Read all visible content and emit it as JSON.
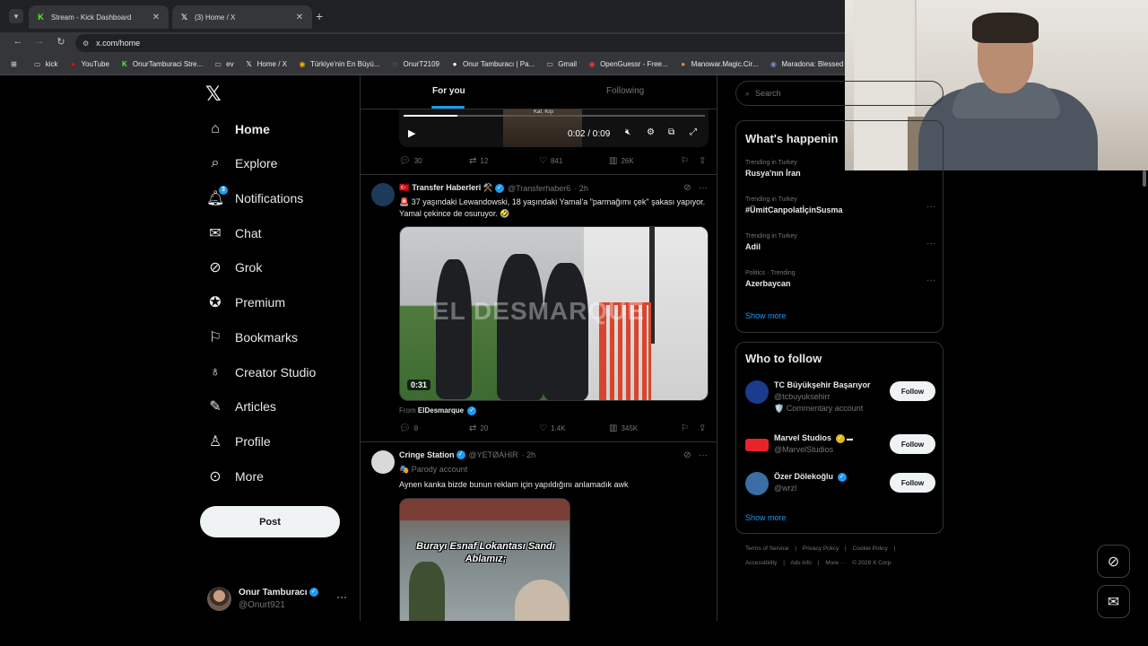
{
  "browser": {
    "tabs": [
      {
        "title": "Stream - Kick Dashboard",
        "favicon": "kick-logo",
        "color": "#53fc18",
        "active": false
      },
      {
        "title": "(3) Home / X",
        "favicon": "x-logo",
        "color": "#ffffff",
        "active": true
      }
    ],
    "url": "x.com/home",
    "bookmarks": [
      {
        "label": "kick",
        "icon": "folder-icon"
      },
      {
        "label": "YouTube",
        "icon": "youtube-icon"
      },
      {
        "label": "OnurTamburaci Stre...",
        "icon": "kick-icon"
      },
      {
        "label": "ev",
        "icon": "folder-icon"
      },
      {
        "label": "Home / X",
        "icon": "x-icon"
      },
      {
        "label": "Türkiye'nin En Büyü...",
        "icon": "globe-icon"
      },
      {
        "label": "OnurT2109",
        "icon": "globe-icon"
      },
      {
        "label": "Onur Tamburacı | Pa...",
        "icon": "patreon-icon"
      },
      {
        "label": "Gmail",
        "icon": "folder-icon"
      },
      {
        "label": "OpenGuessr - Free...",
        "icon": "opengeussr-icon"
      },
      {
        "label": "Manowar.Magic.Cir...",
        "icon": "bitcoin-icon"
      },
      {
        "label": "Maradona: Blessed",
        "icon": "globe-icon"
      }
    ]
  },
  "sidebar": {
    "items": [
      {
        "label": "Home",
        "icon": "home-icon"
      },
      {
        "label": "Explore",
        "icon": "search-icon"
      },
      {
        "label": "Notifications",
        "icon": "bell-icon",
        "badge": "3"
      },
      {
        "label": "Chat",
        "icon": "mail-icon"
      },
      {
        "label": "Grok",
        "icon": "grok-icon"
      },
      {
        "label": "Premium",
        "icon": "verified-icon"
      },
      {
        "label": "Bookmarks",
        "icon": "bookmark-icon"
      },
      {
        "label": "Creator Studio",
        "icon": "creator-icon"
      },
      {
        "label": "Articles",
        "icon": "article-icon"
      },
      {
        "label": "Profile",
        "icon": "person-icon"
      },
      {
        "label": "More",
        "icon": "more-circle-icon"
      }
    ],
    "post_label": "Post",
    "account": {
      "name": "Onur Tamburacı",
      "handle": "@Onurt921"
    }
  },
  "timeline": {
    "tabs": [
      "For you",
      "Following"
    ],
    "tweet1": {
      "video_time": "0:02 / 0:09",
      "video_thumb_text": "Kaf, Kişi",
      "progress": 0.18,
      "replies": "30",
      "reposts": "12",
      "likes": "841",
      "views": "26K"
    },
    "tweet2": {
      "name": "Transfer Haberleri ⚒️",
      "handle": "@Transferhaber6",
      "time": "· 2h",
      "text": "🚨 37 yaşındaki Lewandowski, 18 yaşındaki Yamal'a \"parmağımı çek\" şakası yapıyor. Yamal çekince de osuruyor. 🤣",
      "video_watermark": "EL DESMARQUE",
      "duration": "0:31",
      "from_label": "From",
      "from_name": "ElDesmarque",
      "replies": "8",
      "reposts": "20",
      "likes": "1.4K",
      "views": "345K"
    },
    "tweet3": {
      "name": "Cringe Station",
      "handle": "@YETØAHIR",
      "time": "· 2h",
      "badge": "🎭 Parody account",
      "text": "Aynen kanka bizde bunun reklam için yapıldığını anlamadık awk",
      "image_caption": "Burayı Esnaf Lokantası Sandı Ablamız;"
    }
  },
  "right": {
    "search_placeholder": "Search",
    "trends_title": "What's happenin",
    "trends": [
      {
        "meta": "Trending in Turkey",
        "name": "Rusya'nın İran"
      },
      {
        "meta": "Trending in Turkey",
        "name": "#ÜmitCanpolatİçinSusma"
      },
      {
        "meta": "Trending in Turkey",
        "name": "Adil"
      },
      {
        "meta": "Politics · Trending",
        "name": "Azerbaycan"
      }
    ],
    "show_more": "Show more",
    "wtf_title": "Who to follow",
    "who_to_follow": [
      {
        "name": "TC Büyükşehir Başarıyor",
        "handle": "@tcbuyuksehirr",
        "extra": "🛡️ Commentary account",
        "follow": "Follow",
        "avatar_color": "#1b3b8c"
      },
      {
        "name": "Marvel Studios",
        "handle": "@MarvelStudios",
        "extra": "",
        "follow": "Follow",
        "avatar_color": "#e62429"
      },
      {
        "name": "Özer Dölekoğlu",
        "handle": "@wrzl",
        "extra": "",
        "follow": "Follow",
        "avatar_color": "#3a6ea5"
      }
    ],
    "wtf_show_more": "Show more",
    "footer": [
      "Terms of Service",
      "|",
      "Privacy Policy",
      "|",
      "Cookie Policy",
      "|"
    ],
    "footer2": [
      "Accessibility",
      "|",
      "Ads info",
      "|",
      "More ···",
      "© 2026 X Corp."
    ]
  }
}
